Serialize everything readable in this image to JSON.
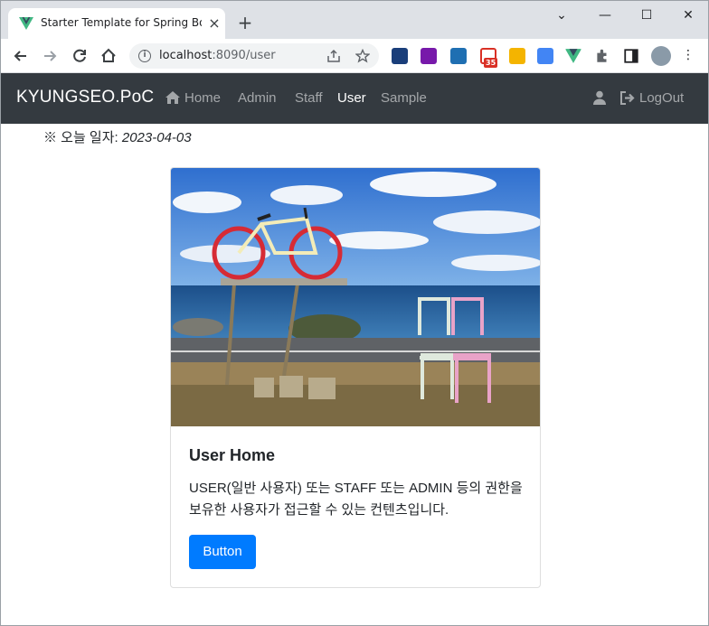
{
  "browser": {
    "tab_title": "Starter Template for Spring Boot",
    "url_host": "localhost",
    "url_rest": ":8090/user",
    "gmail_badge": "35"
  },
  "navbar": {
    "brand": "KYUNGSEO.PoC",
    "links": [
      {
        "label": "Home",
        "icon": "home-icon"
      },
      {
        "label": "Admin"
      },
      {
        "label": "Staff"
      },
      {
        "label": "User",
        "active": true
      },
      {
        "label": "Sample"
      }
    ],
    "logout_label": "LogOut"
  },
  "today": {
    "label": "※ 오늘 일자:",
    "date": "2023-04-03"
  },
  "card": {
    "title": "User Home",
    "text": "USER(일반 사용자) 또는 STAFF 또는 ADMIN 등의 권한을 보유한 사용자가 접근할 수 있는 컨텐츠입니다.",
    "button": "Button"
  },
  "colors": {
    "navbar_bg": "#343a40",
    "primary": "#007bff"
  }
}
